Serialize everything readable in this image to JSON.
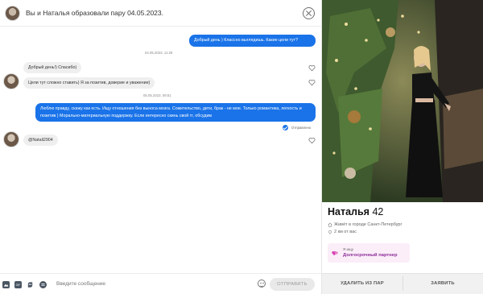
{
  "header": {
    "title": "Вы и Наталья образовали пару 04.05.2023."
  },
  "messages": [
    {
      "side": "out",
      "text": "Добрый день ) Классно выглядишь. Какие цели тут?"
    },
    {
      "side": "stamp",
      "text": "04.05.2023, 11:29"
    },
    {
      "side": "in",
      "text": "Добрый день!) Спасибо)"
    },
    {
      "side": "in",
      "text": "Цели тут сложно ставить) Я за позитив, доверие и уважение)"
    },
    {
      "side": "stamp",
      "text": "05.05.2023, 09:51"
    },
    {
      "side": "out",
      "text": "Люблю правду, скажу как есть. Ищу отношения без выноса мозга. Сожительство, дети, брак - не мое. Только романтика, легкость и позитив ) Морально-материальную поддержку. Если интересно скинь свой тг, обсудим"
    },
    {
      "side": "in",
      "text": "@Natali2904"
    }
  ],
  "read_status": "Отправлено",
  "composer": {
    "placeholder": "Введите сообщение",
    "send_label": "ОТПРАВИТЬ",
    "gif_label": "GIF"
  },
  "profile": {
    "name": "Наталья",
    "age": "42",
    "city": "Живёт в городе Санкт-Петербург",
    "distance": "2 км от вас",
    "goal_label": "Я ищу",
    "goal_value": "Долгосрочный партнер"
  },
  "actions": {
    "remove": "УДАЛИТЬ ИЗ ПАР",
    "report": "ЗАЯВИТЬ"
  },
  "colors": {
    "accent": "#1a73e8",
    "goal_text": "#8e2f9a",
    "goal_bg": "#fbeef8"
  },
  "icons": [
    "close-icon",
    "heart-icon",
    "check-icon",
    "image-icon",
    "gif-icon",
    "sticker-icon",
    "mic-icon",
    "emoji-icon",
    "home-icon",
    "location-pin-icon",
    "hearts-icon"
  ]
}
